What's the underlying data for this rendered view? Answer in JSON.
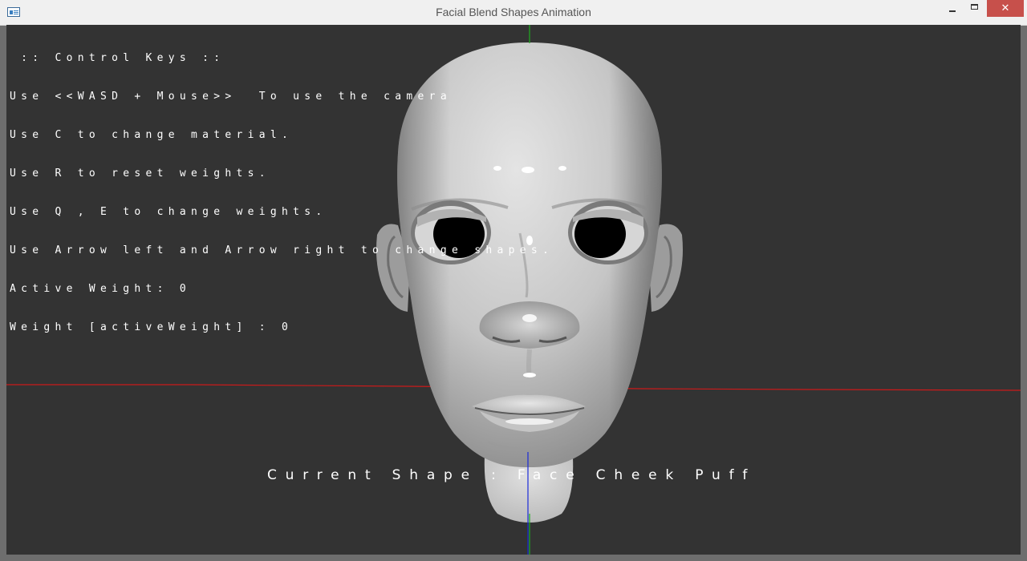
{
  "window": {
    "title": "Facial Blend Shapes Animation",
    "close_symbol": "✕",
    "controls": [
      "minimize",
      "maximize",
      "close"
    ]
  },
  "overlay": {
    "lines": [
      " :: Control Keys ::",
      "Use <<WASD + Mouse>>  To use the camera",
      "Use C to change material.",
      "Use R to reset weights.",
      "Use Q , E to change weights.",
      "Use Arrow left and Arrow right to change shapes.",
      "Active Weight: 0",
      "Weight [activeWeight] : 0"
    ],
    "current_shape": "Current Shape : Face Cheek Puff"
  },
  "scene": {
    "background": "#333333",
    "axis_colors": {
      "x": "#cc1a1a",
      "y": "#1fae1f",
      "z": "#1a2ad8"
    },
    "model": "head",
    "icons": [
      "app-icon",
      "minimize-icon",
      "maximize-icon",
      "close-icon"
    ]
  }
}
